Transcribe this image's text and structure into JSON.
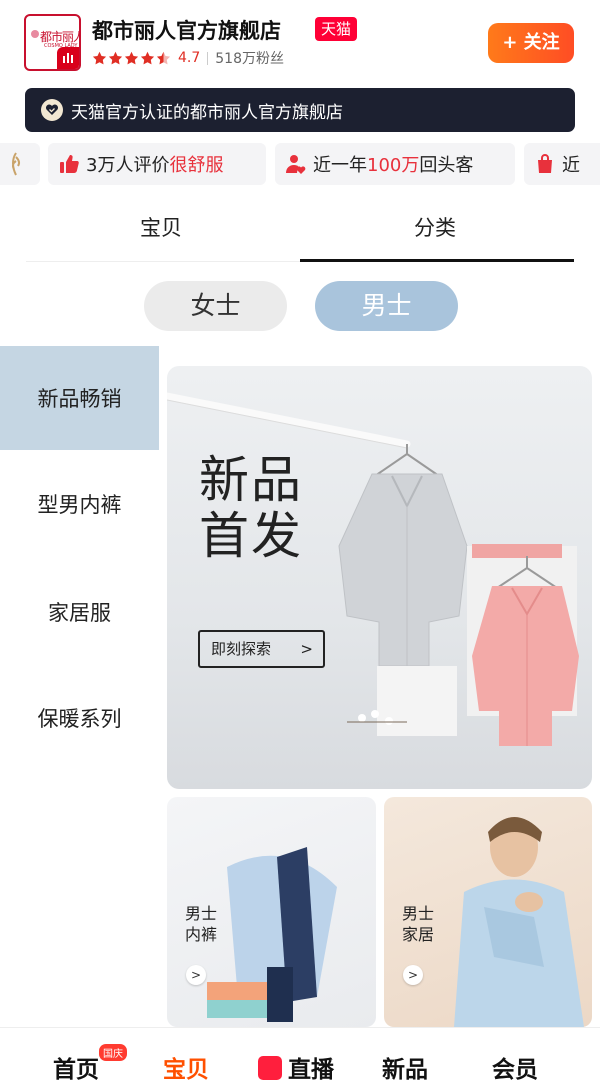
{
  "header": {
    "logo_text": "都市丽人",
    "logo_sub": "COSMO LADY",
    "shop_name": "都市丽人官方旗舰店",
    "platform_badge": "天猫",
    "rating": "4.7",
    "rating_stars": 4.5,
    "fans": "518万粉丝",
    "follow_label": "+ 关注"
  },
  "cert_banner": {
    "text": "天猫官方认证的都市丽人官方旗舰店"
  },
  "chips": [
    {
      "icon": "thumbs-up-icon",
      "pre": "3万人评价",
      "hl": "很舒服",
      "post": ""
    },
    {
      "icon": "user-heart-icon",
      "pre": "近一年",
      "hl": "100万",
      "post": "回头客"
    },
    {
      "icon": "bag-icon",
      "pre": "近",
      "hl": "",
      "post": ""
    }
  ],
  "tabs": {
    "items": [
      "宝贝",
      "分类"
    ],
    "active": "分类"
  },
  "gender": {
    "female": "女士",
    "male": "男士",
    "active": "男士"
  },
  "categories": [
    {
      "label": "新品畅销",
      "active": true
    },
    {
      "label": "型男内裤",
      "active": false
    },
    {
      "label": "家居服",
      "active": false
    },
    {
      "label": "保暖系列",
      "active": false
    }
  ],
  "hero": {
    "title_line1": "新品",
    "title_line2": "首发",
    "button_label": "即刻探索",
    "button_arrow": ">"
  },
  "cards": [
    {
      "line1": "男士",
      "line2": "内裤",
      "arrow": ">"
    },
    {
      "line1": "男士",
      "line2": "家居",
      "arrow": ">"
    }
  ],
  "bottom_nav": {
    "items": [
      "首页",
      "宝贝",
      "直播",
      "新品",
      "会员"
    ],
    "active": "宝贝",
    "home_badge": "国庆"
  },
  "colors": {
    "accent_red": "#e8313c",
    "follow_orange": "#ff5a1f",
    "active_category_bg": "#c5d6e3",
    "male_toggle": "#a9c4dc"
  }
}
